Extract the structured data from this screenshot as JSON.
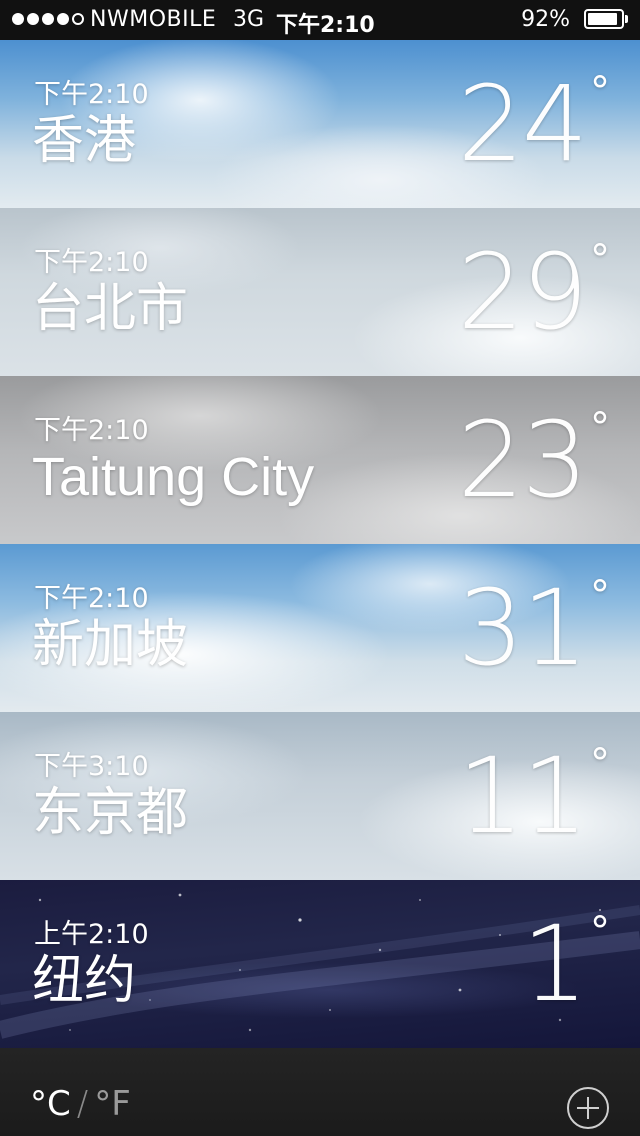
{
  "status_bar": {
    "carrier": "NWMOBILE",
    "network": "3G",
    "time": "下午2:10",
    "battery_percent": "92%",
    "battery_level": 0.92,
    "signal_bars_filled": 4,
    "signal_bars_total": 5
  },
  "cities": [
    {
      "time": "下午2:10",
      "name": "香港",
      "temp": "24",
      "degree": "°",
      "background": "sky-top"
    },
    {
      "time": "下午2:10",
      "name": "台北市",
      "temp": "29",
      "degree": "°",
      "background": "cloudy"
    },
    {
      "time": "下午2:10",
      "name": "Taitung City",
      "temp": "23",
      "degree": "°",
      "background": "overcast-gray"
    },
    {
      "time": "下午2:10",
      "name": "新加坡",
      "temp": "31",
      "degree": "°",
      "background": "sky"
    },
    {
      "time": "下午3:10",
      "name": "东京都",
      "temp": "11",
      "degree": "°",
      "background": "cloudy"
    },
    {
      "time": "上午2:10",
      "name": "纽约",
      "temp": "1",
      "degree": "°",
      "background": "night"
    }
  ],
  "bottom_bar": {
    "unit_celsius": "°C",
    "unit_separator": "/",
    "unit_fahrenheit": "°F",
    "selected_unit": "C",
    "add_icon": "plus-circle-icon"
  },
  "colors": {
    "text": "#ffffff",
    "bottom_bar": "#1e1e1e",
    "unit_inactive": "#9a9a9a",
    "night": "#1b1c3f"
  }
}
